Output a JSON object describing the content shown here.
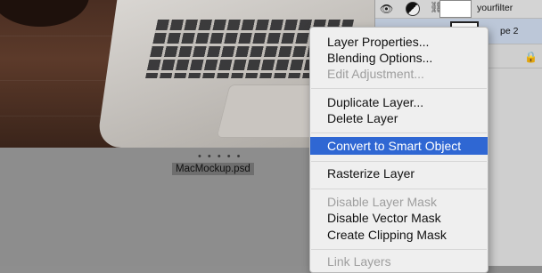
{
  "document": {
    "filename": "MacMockup.psd",
    "dots": "• • • • •"
  },
  "layers_panel": {
    "rows": [
      {
        "name": "yourfilter"
      },
      {
        "name": "pe 2"
      },
      {
        "name": ""
      }
    ]
  },
  "context_menu": {
    "groups": [
      [
        {
          "label": "Layer Properties...",
          "enabled": true
        },
        {
          "label": "Blending Options...",
          "enabled": true
        },
        {
          "label": "Edit Adjustment...",
          "enabled": false
        }
      ],
      [
        {
          "label": "Duplicate Layer...",
          "enabled": true
        },
        {
          "label": "Delete Layer",
          "enabled": true
        }
      ],
      [
        {
          "label": "Convert to Smart Object",
          "enabled": true,
          "highlighted": true
        }
      ],
      [
        {
          "label": "Rasterize Layer",
          "enabled": true
        }
      ],
      [
        {
          "label": "Disable Layer Mask",
          "enabled": false
        },
        {
          "label": "Disable Vector Mask",
          "enabled": true
        },
        {
          "label": "Create Clipping Mask",
          "enabled": true
        }
      ],
      [
        {
          "label": "Link Layers",
          "enabled": false
        }
      ]
    ]
  },
  "colors": {
    "highlight": "#2f67d3",
    "menu_bg": "#efefef",
    "disabled_text": "#9e9e9e"
  }
}
